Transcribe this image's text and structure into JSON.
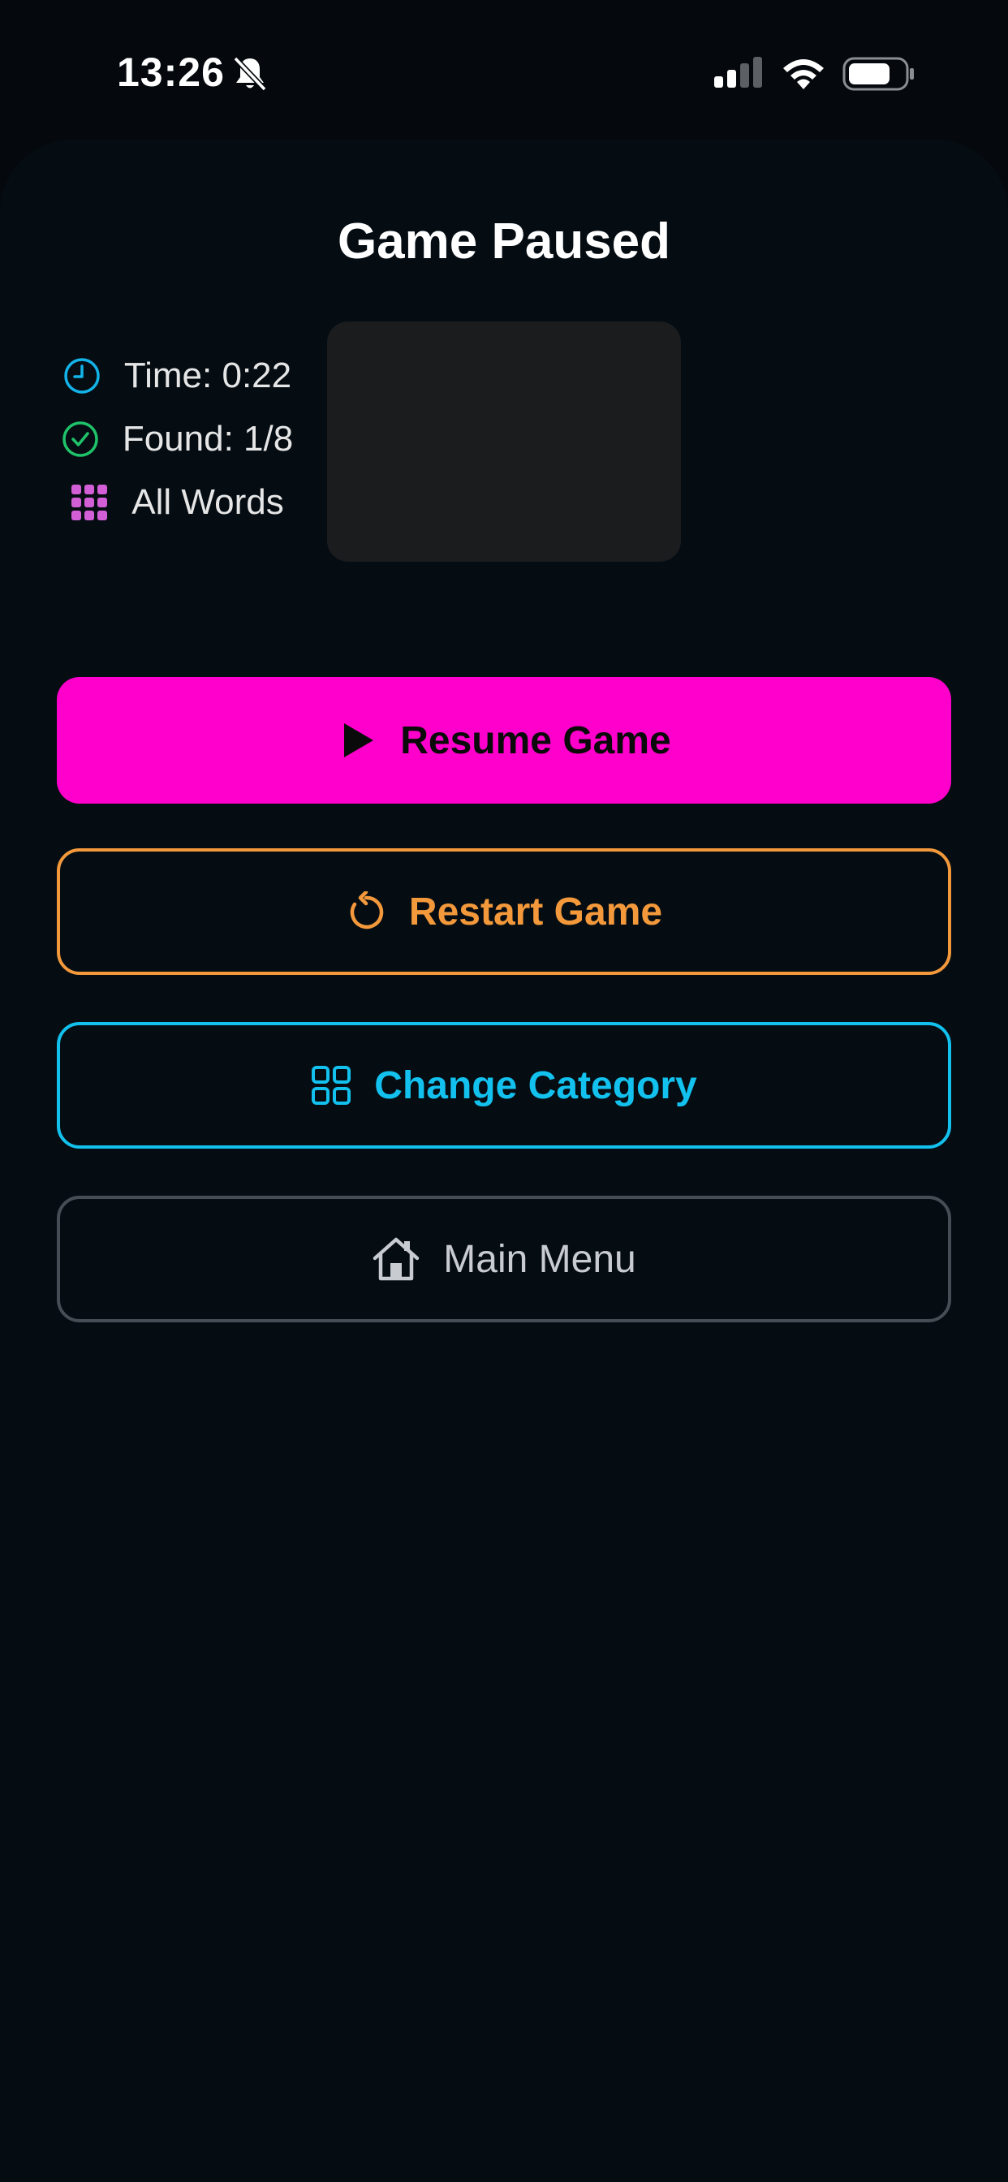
{
  "status_bar": {
    "time": "13:26"
  },
  "pause_screen": {
    "title": "Game Paused",
    "stats": {
      "time_label": "Time: 0:22",
      "found_label": "Found: 1/8",
      "category_label": "All Words"
    },
    "buttons": {
      "resume": "Resume Game",
      "restart": "Restart Game",
      "change_category": "Change Category",
      "main_menu": "Main Menu"
    }
  },
  "colors": {
    "background": "#05090d",
    "resume_accent": "#ff00cc",
    "restart_accent": "#f3993b",
    "category_accent": "#13c1ee",
    "menu_border": "#474d54",
    "time_icon": "#13b3e8",
    "found_icon": "#1fc36a",
    "words_icon": "#d25fd6"
  },
  "icons": {
    "time": "clock-icon",
    "found": "check-circle-icon",
    "category": "grid-icon",
    "resume": "play-icon",
    "restart": "restart-icon",
    "change_category": "category-grid-icon",
    "main_menu": "home-icon"
  }
}
